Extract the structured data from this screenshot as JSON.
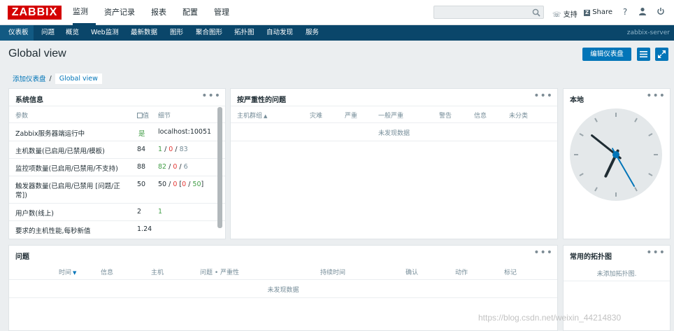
{
  "header": {
    "logo": "ZABBIX",
    "menu": [
      {
        "label": "监测",
        "active": true
      },
      {
        "label": "资产记录",
        "active": false
      },
      {
        "label": "报表",
        "active": false
      },
      {
        "label": "配置",
        "active": false
      },
      {
        "label": "管理",
        "active": false
      }
    ],
    "support_label": "支持",
    "share_label": "Share",
    "help_icon": "help-icon",
    "user_icon": "user-icon",
    "power_icon": "power-icon",
    "search_placeholder": ""
  },
  "subnav": {
    "items": [
      {
        "label": "仪表板",
        "active": true
      },
      {
        "label": "问题"
      },
      {
        "label": "概览"
      },
      {
        "label": "Web监测"
      },
      {
        "label": "最新数据"
      },
      {
        "label": "图形"
      },
      {
        "label": "聚合图形"
      },
      {
        "label": "拓扑图"
      },
      {
        "label": "自动发现"
      },
      {
        "label": "服务"
      }
    ],
    "server_name": "zabbix-server"
  },
  "page": {
    "title": "Global view",
    "edit_button": "编辑仪表盘",
    "breadcrumb": {
      "parent": "添加仪表盘",
      "separator": "/",
      "current": "Global view"
    }
  },
  "system_info": {
    "title": "系统信息",
    "dots": "•••",
    "columns": {
      "param": "参数",
      "value": "值",
      "detail": "细节"
    },
    "rows": [
      {
        "param": "Zabbix服务器端运行中",
        "value": "是",
        "detail": "localhost:10051"
      },
      {
        "param": "主机数量(已启用/已禁用/模板)",
        "value": "84",
        "d1": "1",
        "d2": "0",
        "d3": "83"
      },
      {
        "param": "监控项数量(已启用/已禁用/不支持)",
        "value": "88",
        "d1": "82",
        "d2": "0",
        "d3": "6"
      },
      {
        "param": "触发器数量(已启用/已禁用 [问题/正",
        "param2": "常])",
        "value": "50",
        "d1": "50",
        "d2": "0",
        "d3": "0",
        "d4": "50"
      },
      {
        "param": "用户数(线上)",
        "value": "2",
        "detail": "1"
      },
      {
        "param": "要求的主机性能,每秒新值",
        "value": "1.24",
        "detail": ""
      }
    ]
  },
  "problems_by_severity": {
    "title": "按严重性的问题",
    "dots": "•••",
    "columns": [
      "主机群组",
      "灾难",
      "严重",
      "一般严重",
      "警告",
      "信息",
      "未分类"
    ],
    "sort_arrow": "▲",
    "no_data": "未发现数据"
  },
  "local_clock": {
    "title": "本地",
    "dots": "•••",
    "hour": 6,
    "minute": 51,
    "second": 25
  },
  "problems": {
    "title": "问题",
    "dots": "•••",
    "columns": [
      "时间",
      "信息",
      "主机",
      "问题 • 严重性",
      "持续时间",
      "确认",
      "动作",
      "标记"
    ],
    "sort_arrow": "▼",
    "no_data": "未发现数据"
  },
  "fav_maps": {
    "title": "常用的拓扑图",
    "dots": "•••",
    "empty": "未添加拓扑图."
  },
  "watermark": "https://blog.csdn.net/weixin_44214830",
  "colors": {
    "brand": "#d40000",
    "nav": "#0a466a",
    "button": "#0275b8",
    "green": "#429e47",
    "red": "#e33734"
  }
}
